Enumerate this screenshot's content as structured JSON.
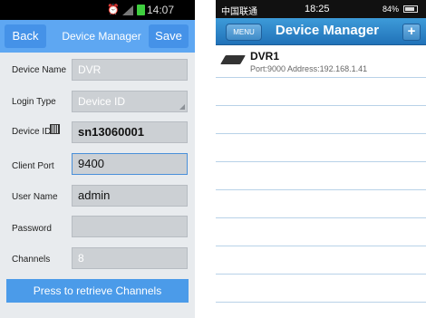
{
  "left": {
    "status": {
      "icons": [
        "alarm-icon",
        "signal-icon"
      ],
      "battery_color": "#3fcf3f",
      "time": "14:07"
    },
    "toolbar": {
      "back": "Back",
      "title": "Device Manager",
      "save": "Save"
    },
    "form": {
      "device_name": {
        "label": "Device Name",
        "value": "DVR"
      },
      "login_type": {
        "label": "Login Type",
        "value": "Device ID"
      },
      "device_id": {
        "label": "Device ID",
        "value": "sn13060001"
      },
      "client_port": {
        "label": "Client Port",
        "value": "9400"
      },
      "user_name": {
        "label": "User Name",
        "value": "admin"
      },
      "password": {
        "label": "Password",
        "value": ""
      },
      "channels": {
        "label": "Channels",
        "value": "8"
      }
    },
    "retrieve_button": "Press to retrieve Channels",
    "accent": "#5ea7f2"
  },
  "right": {
    "status": {
      "carrier": "中国联通",
      "time": "18:25",
      "battery": "84%"
    },
    "nav": {
      "menu": "MENU",
      "title": "Device Manager",
      "add": "+"
    },
    "devices": [
      {
        "name": "DVR1",
        "port": "Port:9000",
        "address": "Address:192.168.1.41"
      }
    ],
    "accent": "#2172b8"
  }
}
